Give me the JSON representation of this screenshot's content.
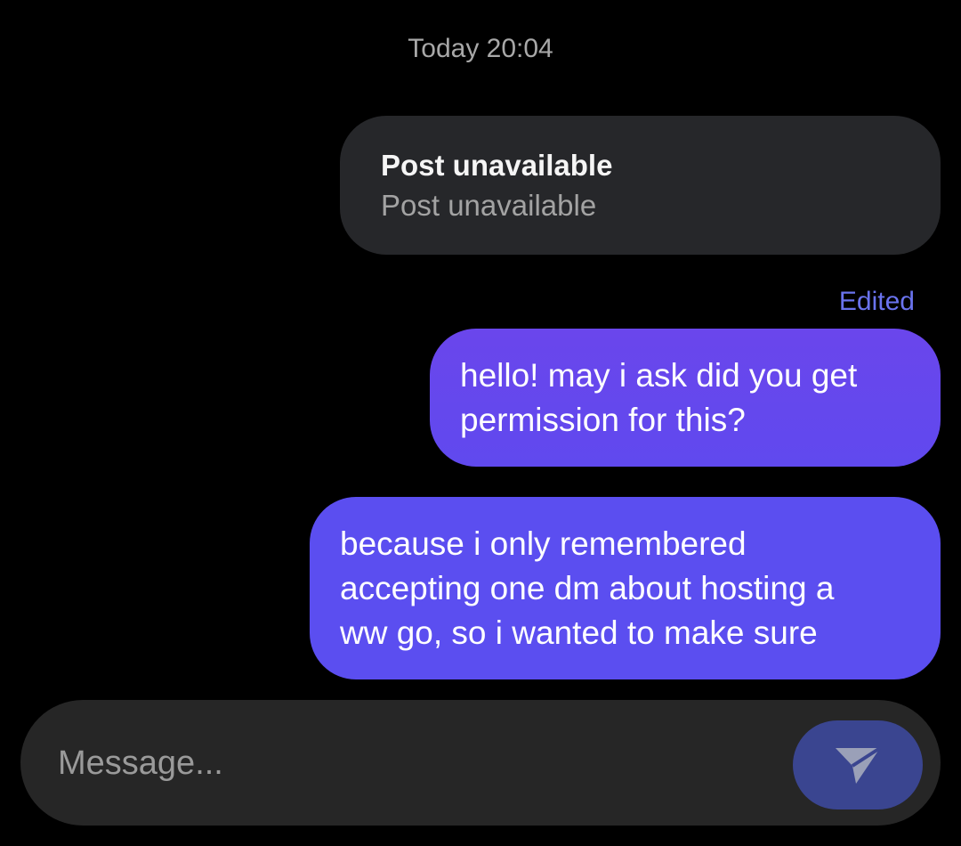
{
  "thread": {
    "timestamp": "Today 20:04"
  },
  "shared_post": {
    "title": "Post unavailable",
    "subtitle": "Post unavailable"
  },
  "messages": [
    {
      "status": "Edited",
      "text": "hello! may i ask did you get\npermission for this?"
    },
    {
      "text": "because i only remembered\naccepting one dm about hosting a\nww go, so i wanted to make sure"
    }
  ],
  "composer": {
    "placeholder": "Message...",
    "value": "",
    "send_icon": "send-icon"
  },
  "colors": {
    "background": "#000000",
    "received_bubble": "#26272a",
    "sent_bubble": "#5b4ef0",
    "edited_label": "#6a73ee",
    "send_button": "#3a4590"
  }
}
